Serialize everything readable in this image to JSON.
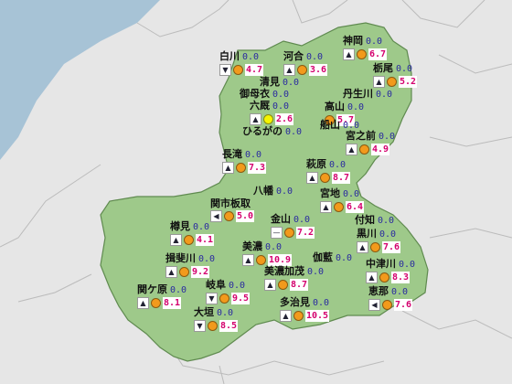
{
  "colors": {
    "sea": "#a7c3d6",
    "land": "#e6e6e6",
    "region": "#9ec98a",
    "region_border": "#5f8a4f",
    "sun": "#f29a1c",
    "highlight": "#f5f500",
    "temp": "#d4006e"
  },
  "stations": [
    {
      "name": "神岡",
      "precip": "0.0",
      "temp": "6.7",
      "wind": "north-icon"
    },
    {
      "name": "白川",
      "precip": "0.0",
      "temp": "4.7",
      "wind": "south-icon"
    },
    {
      "name": "河合",
      "precip": "0.0",
      "temp": "3.6",
      "wind": "north-icon"
    },
    {
      "name": "栃尾",
      "precip": "0.0",
      "temp": "5.2",
      "wind": "north-icon"
    },
    {
      "name": "清見",
      "precip": "0.0",
      "temp": "",
      "wind": ""
    },
    {
      "name": "御母衣",
      "precip": "0.0",
      "temp": "",
      "wind": ""
    },
    {
      "name": "丹生川",
      "precip": "0.0",
      "temp": "",
      "wind": ""
    },
    {
      "name": "六厩",
      "precip": "0.0",
      "temp": "2.6",
      "wind": "north-icon",
      "dot": "yellow"
    },
    {
      "name": "高山",
      "precip": "0.0",
      "temp": "5.7",
      "wind": ""
    },
    {
      "name": "ひるがの",
      "precip": "0.0",
      "temp": "",
      "wind": ""
    },
    {
      "name": "船山",
      "precip": "0.0",
      "temp": "",
      "wind": ""
    },
    {
      "name": "宮之前",
      "precip": "0.0",
      "temp": "4.9",
      "wind": "north-icon"
    },
    {
      "name": "長滝",
      "precip": "0.0",
      "temp": "7.3",
      "wind": "north-icon"
    },
    {
      "name": "萩原",
      "precip": "0.0",
      "temp": "8.7",
      "wind": "north-icon"
    },
    {
      "name": "八幡",
      "precip": "0.0",
      "temp": "",
      "wind": ""
    },
    {
      "name": "宮地",
      "precip": "0.0",
      "temp": "6.4",
      "wind": "north-icon"
    },
    {
      "name": "関市板取",
      "precip": "",
      "temp": "5.0",
      "wind": "west-icon"
    },
    {
      "name": "付知",
      "precip": "0.0",
      "temp": "",
      "wind": ""
    },
    {
      "name": "金山",
      "precip": "0.0",
      "temp": "7.2",
      "wind": "calm-icon"
    },
    {
      "name": "樽見",
      "precip": "0.0",
      "temp": "4.1",
      "wind": "north-icon"
    },
    {
      "name": "黒川",
      "precip": "0.0",
      "temp": "7.6",
      "wind": "north-icon"
    },
    {
      "name": "美濃",
      "precip": "0.0",
      "temp": "10.9",
      "wind": "north-icon"
    },
    {
      "name": "揖斐川",
      "precip": "0.0",
      "temp": "9.2",
      "wind": "north-icon"
    },
    {
      "name": "伽藍",
      "precip": "0.0",
      "temp": "",
      "wind": ""
    },
    {
      "name": "中津川",
      "precip": "0.0",
      "temp": "8.3",
      "wind": "north-icon"
    },
    {
      "name": "美濃加茂",
      "precip": "0.0",
      "temp": "8.7",
      "wind": "north-icon"
    },
    {
      "name": "関ケ原",
      "precip": "0.0",
      "temp": "8.1",
      "wind": "north-icon"
    },
    {
      "name": "岐阜",
      "precip": "0.0",
      "temp": "9.5",
      "wind": "south-icon"
    },
    {
      "name": "恵那",
      "precip": "0.0",
      "temp": "7.6",
      "wind": "west-icon"
    },
    {
      "name": "多治見",
      "precip": "0.0",
      "temp": "10.5",
      "wind": "north-icon"
    },
    {
      "name": "大垣",
      "precip": "0.0",
      "temp": "8.5",
      "wind": "south-icon"
    }
  ]
}
